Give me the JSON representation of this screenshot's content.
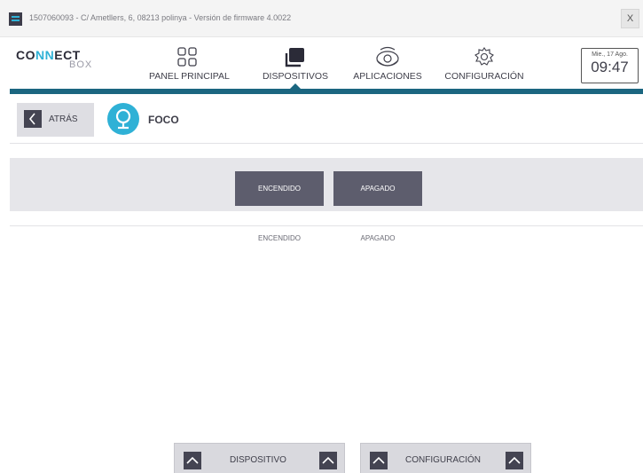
{
  "window": {
    "title": "1507060093 - C/ Ametllers, 6, 08213 polinya - Versión de firmware 4.0022",
    "close_label": "X"
  },
  "brand": {
    "part1": "CONNECT",
    "part2": "BOX"
  },
  "nav": {
    "items": [
      {
        "label": "PANEL PRINCIPAL",
        "icon": "grid-icon"
      },
      {
        "label": "DISPOSITIVOS",
        "icon": "devices-icon",
        "active": true
      },
      {
        "label": "APLICACIONES",
        "icon": "applications-icon"
      },
      {
        "label": "CONFIGURACIÓN",
        "icon": "gear-icon"
      }
    ]
  },
  "clock": {
    "date": "Mie., 17 Ago.",
    "time": "09:47"
  },
  "subheader": {
    "back_label": "ATRÁS",
    "device_name": "FOCO",
    "device_icon": "light-bulb-icon"
  },
  "controls": {
    "on_label": "ENCENDIDO",
    "off_label": "APAGADO"
  },
  "states": {
    "on_label": "ENCENDIDO",
    "off_label": "APAGADO"
  },
  "bottom_tabs": {
    "device_label": "DISPOSITIVO",
    "config_label": "CONFIGURACIÓN"
  },
  "colors": {
    "accent": "#1b6680",
    "brand_blue": "#2fb1d6",
    "button": "#5d5d6d"
  }
}
